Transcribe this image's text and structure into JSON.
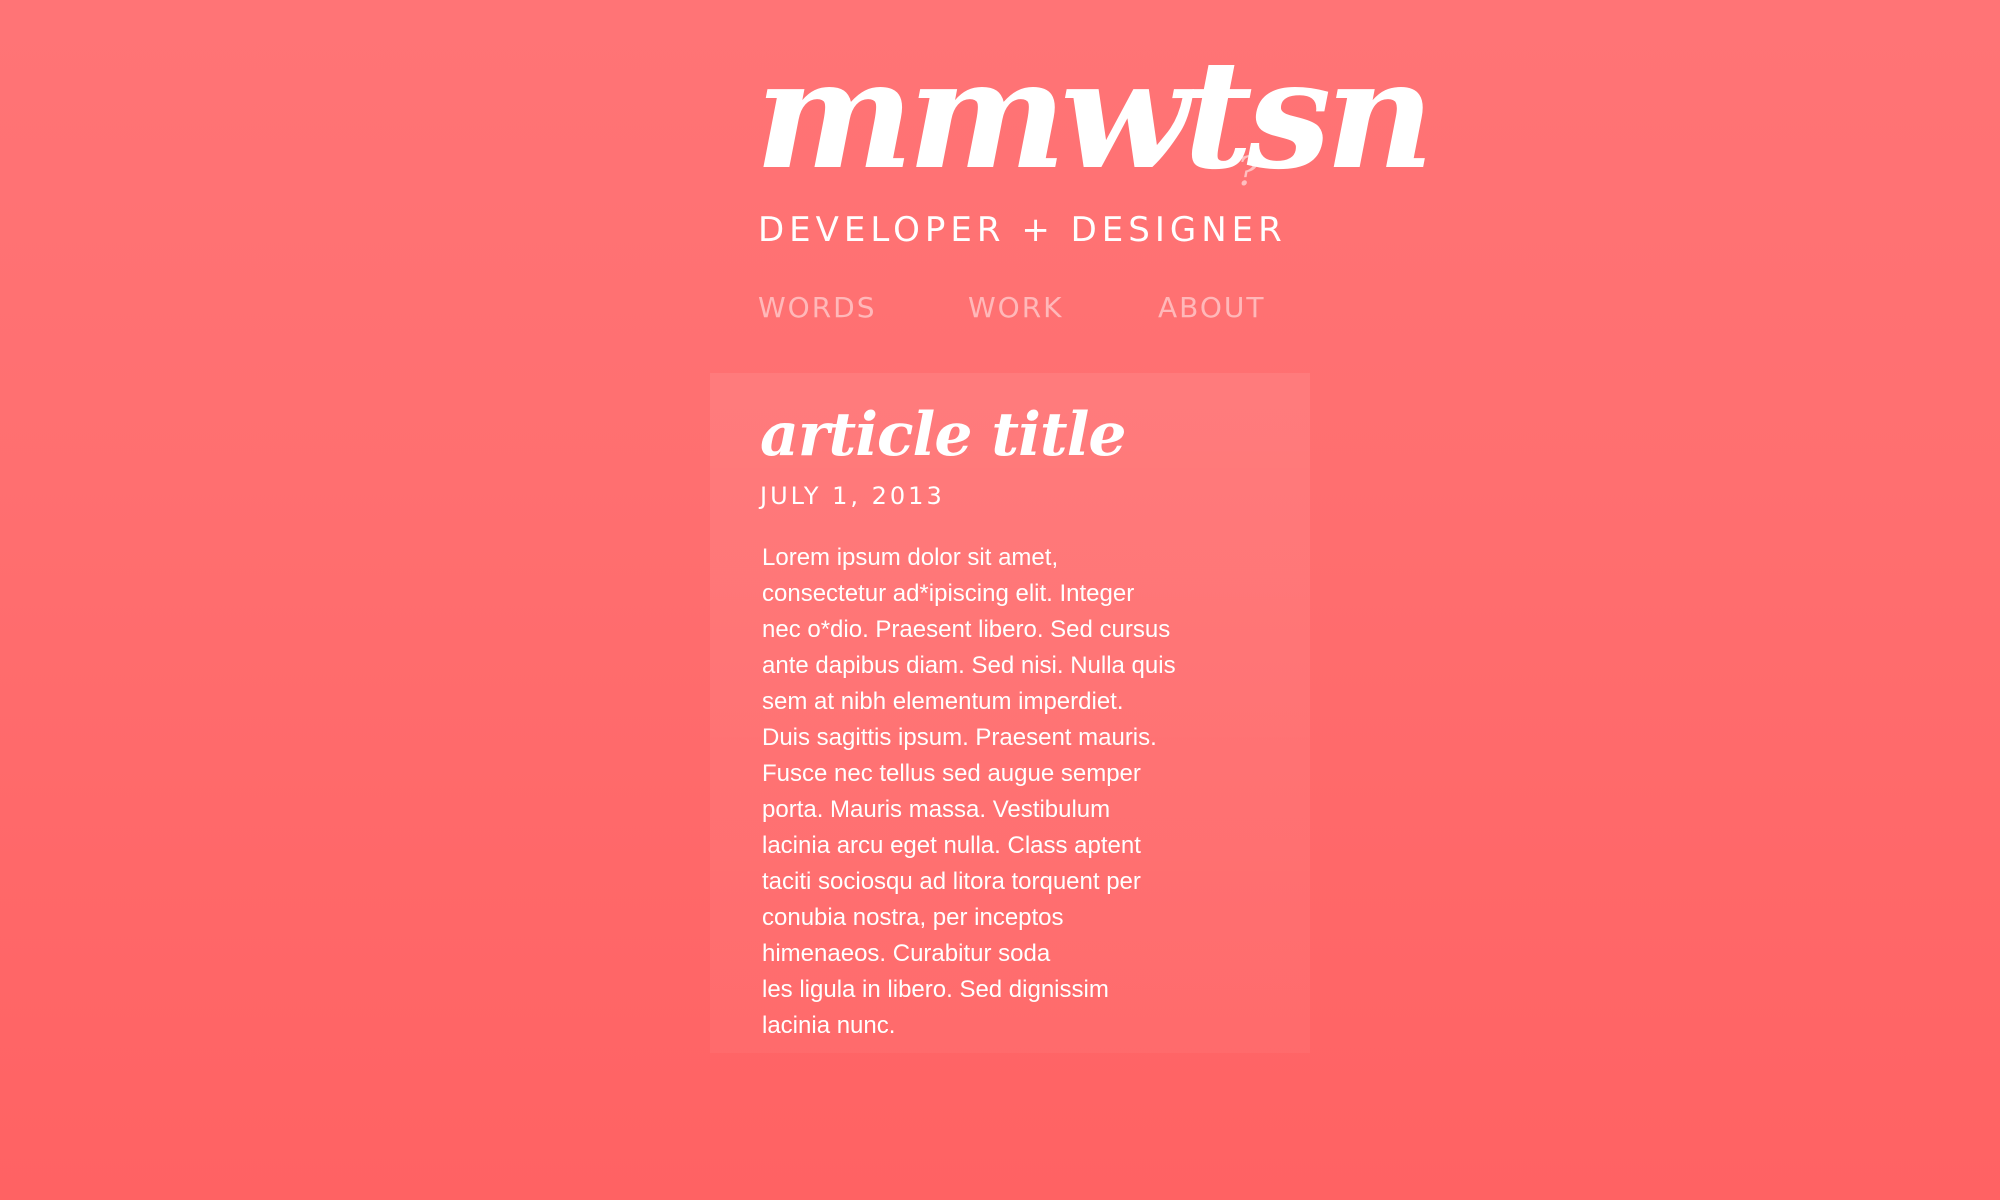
{
  "site": {
    "logo_text": "mmwtsn",
    "logo_mark": "?",
    "tagline": "DEVELOPER + DESIGNER"
  },
  "nav": {
    "items": [
      {
        "label": "WORDS"
      },
      {
        "label": "WORK"
      },
      {
        "label": "ABOUT"
      }
    ]
  },
  "article": {
    "title": "article title",
    "date": "JULY 1, 2013",
    "body_lines": [
      "Lorem ipsum dolor sit amet,",
      "consectetur ad*ipiscing elit. Integer",
      "nec o*dio. Praesent libero. Sed cursus",
      "ante dapibus diam. Sed nisi. Nulla quis",
      "sem at nibh elementum imperdiet.",
      "Duis sagittis ipsum. Praesent mauris.",
      "Fusce nec tellus sed augue semper",
      "porta. Mauris massa. Vestibulum",
      "lacinia arcu eget nulla. Class aptent",
      "taciti sociosqu ad litora torquent per",
      "conubia nostra, per inceptos",
      "himenaeos. Curabitur soda",
      "les ligula in libero. Sed dignissim",
      "lacinia nunc."
    ]
  },
  "colors": {
    "background_top": "#ff7476",
    "background_bottom": "#ff6263",
    "text": "#ffffff"
  }
}
